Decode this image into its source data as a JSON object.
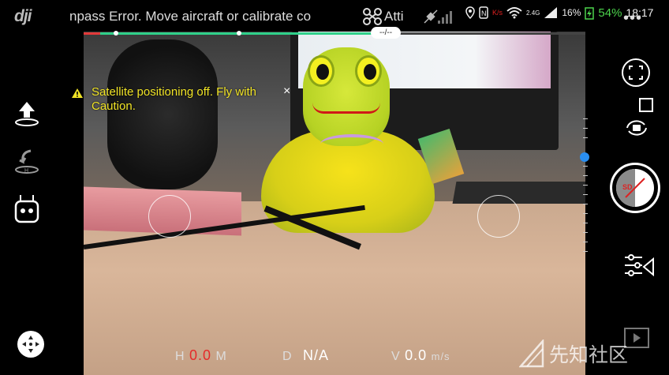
{
  "app": {
    "logo": "dji"
  },
  "status_bar": {
    "ticker_message": "npass Error. Move aircraft or calibrate co",
    "flight_mode": "Atti",
    "android": {
      "battery_percent": "16%",
      "remote_battery": "54%",
      "clock": "18:17",
      "net": "2.4G",
      "wifi_unit": "K/s"
    },
    "more_label": "•••"
  },
  "timeline": {
    "time_left": "--/--",
    "progress": 0.62
  },
  "warning": {
    "text": "Satellite positioning off. Fly with Caution.",
    "close": "×"
  },
  "telemetry": {
    "height": {
      "label": "H",
      "value": "0.0",
      "unit": "M"
    },
    "distance": {
      "label": "D",
      "value": "N/A"
    },
    "vspeed": {
      "label": "V",
      "value": "0.0",
      "unit": "m/s"
    }
  },
  "camera": {
    "mode_label": "SD"
  },
  "watermark": {
    "text": "先知社区"
  },
  "icons": [
    "takeoff-icon",
    "return-home-icon",
    "remote-controller-icon",
    "move-icon",
    "camera-switch-icon",
    "af-ae-icon",
    "photo-video-toggle-icon",
    "settings-slider-icon",
    "playback-icon"
  ],
  "colors": {
    "warning": "#f1e426",
    "accent_blue": "#2a8ef0",
    "battery_green": "#4cd34c",
    "alert_red": "#e52a2a"
  }
}
